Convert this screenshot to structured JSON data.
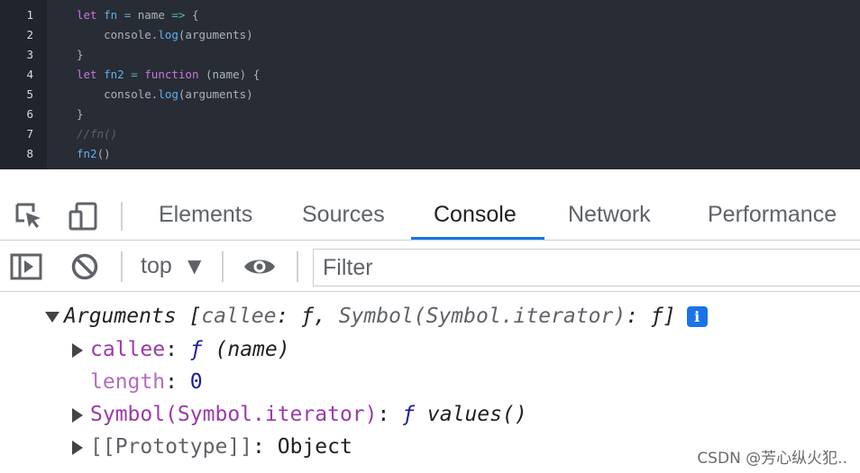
{
  "editor": {
    "lines": [
      {
        "n": "1",
        "tokens": [
          [
            "kw",
            "let "
          ],
          [
            "var",
            "fn"
          ],
          [
            "op",
            " = "
          ],
          [
            "plain",
            "name "
          ],
          [
            "op",
            "=>"
          ],
          [
            "plain",
            " {"
          ]
        ]
      },
      {
        "n": "2",
        "tokens": [
          [
            "plain",
            "    console."
          ],
          [
            "fn",
            "log"
          ],
          [
            "plain",
            "(arguments)"
          ]
        ]
      },
      {
        "n": "3",
        "tokens": [
          [
            "plain",
            "}"
          ]
        ]
      },
      {
        "n": "4",
        "tokens": [
          [
            "kw",
            "let "
          ],
          [
            "var",
            "fn2"
          ],
          [
            "op",
            " = "
          ],
          [
            "kw",
            "function"
          ],
          [
            "plain",
            " (name) {"
          ]
        ]
      },
      {
        "n": "5",
        "tokens": [
          [
            "plain",
            "    console."
          ],
          [
            "fn",
            "log"
          ],
          [
            "plain",
            "(arguments)"
          ]
        ]
      },
      {
        "n": "6",
        "tokens": [
          [
            "plain",
            "}"
          ]
        ]
      },
      {
        "n": "7",
        "tokens": [
          [
            "cm",
            "//fn()"
          ]
        ]
      },
      {
        "n": "8",
        "tokens": [
          [
            "fn",
            "fn2"
          ],
          [
            "plain",
            "()"
          ]
        ]
      }
    ]
  },
  "devtools": {
    "tabs": {
      "elements": "Elements",
      "sources": "Sources",
      "console": "Console",
      "network": "Network",
      "performance": "Performance"
    },
    "active_tab": "Console",
    "toolbar": {
      "context": "top",
      "context_arrow": "▼",
      "filter_placeholder": "Filter"
    },
    "console": {
      "summary": {
        "label": "Arguments",
        "open": " [",
        "callee_key": "callee",
        "sep1": ": ",
        "f1": "ƒ",
        "comma": ", ",
        "symbol_key": "Symbol(Symbol.iterator)",
        "sep2": ": ",
        "f2": "ƒ",
        "close": "]",
        "badge": "i"
      },
      "callee": {
        "key": "callee",
        "colon": ": ",
        "f": "ƒ",
        "value": " (name)"
      },
      "length": {
        "key": "length",
        "colon": ": ",
        "value": "0"
      },
      "symbol": {
        "key": "Symbol(Symbol.iterator)",
        "colon": ": ",
        "f": "ƒ",
        "value": " values()"
      },
      "prototype": {
        "key": "[[Prototype]]",
        "colon": ": ",
        "value": "Object"
      }
    }
  },
  "watermark": "CSDN @芳心纵火犯.."
}
